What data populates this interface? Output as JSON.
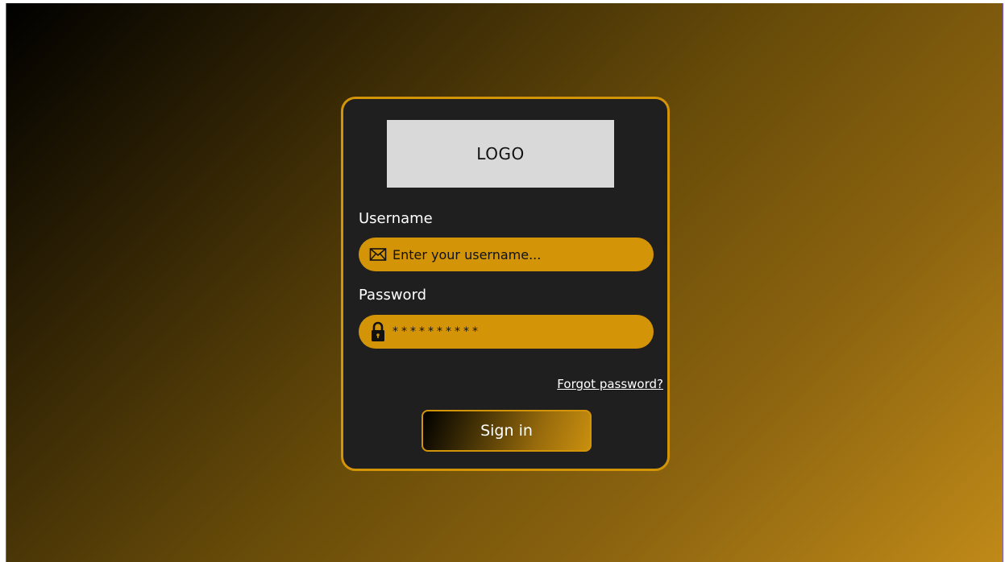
{
  "logo": {
    "text": "LOGO"
  },
  "form": {
    "username": {
      "label": "Username",
      "placeholder": "Enter your username...",
      "icon": "mail-icon"
    },
    "password": {
      "label": "Password",
      "value": "**********",
      "icon": "lock-icon"
    },
    "forgot_link": "Forgot password?",
    "signin_label": "Sign in"
  },
  "colors": {
    "accent": "#d49408",
    "card_background": "#1f1f1f",
    "logo_placeholder": "#d9d9d9"
  }
}
